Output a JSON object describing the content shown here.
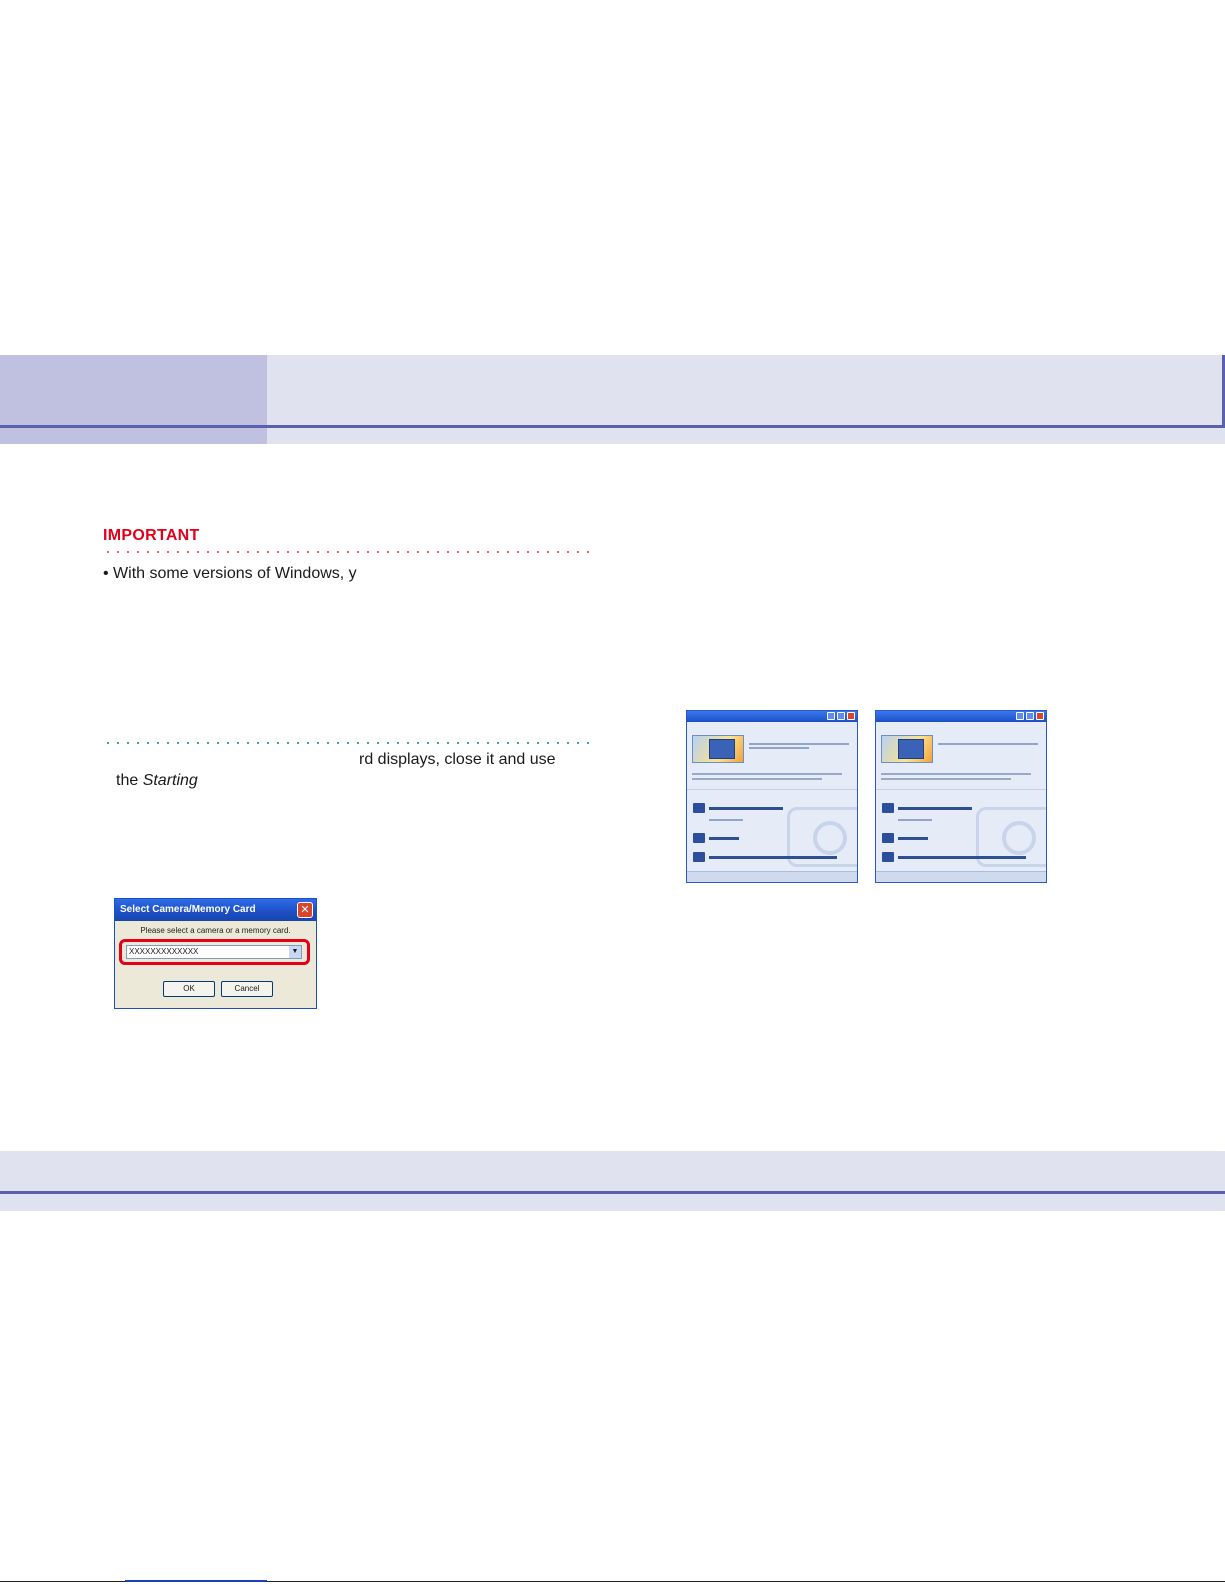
{
  "important": {
    "heading": "IMPORTANT",
    "line1": "• With some versions of Windows, y",
    "line2": "rd displays, close it and use",
    "line3_prefix": "the ",
    "line3_italic": "Starting"
  },
  "dialog": {
    "title": "Select Camera/Memory Card",
    "prompt": "Please select a camera or a memory card.",
    "selected_value": "XXXXXXXXXXXXX",
    "ok_label": "OK",
    "cancel_label": "Cancel",
    "close_glyph": "✕",
    "dropdown_glyph": "▼"
  },
  "colors": {
    "header_dark": "#c0c1e0",
    "header_light": "#e1e2f0",
    "rule": "#5a5fae",
    "important_red": "#e2001a"
  }
}
